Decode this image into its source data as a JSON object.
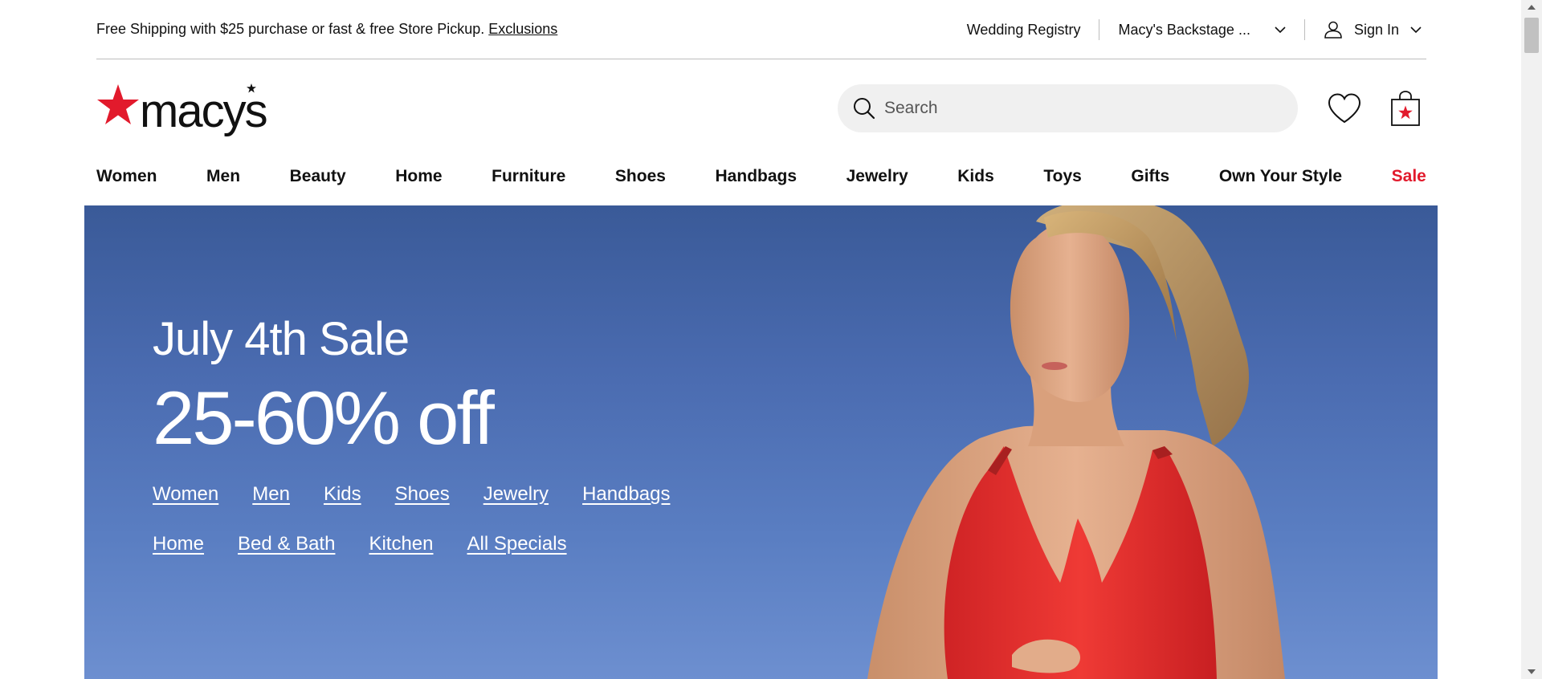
{
  "utility": {
    "promo_text": "Free Shipping with $25 purchase or fast & free Store Pickup.",
    "promo_link": "Exclusions",
    "wedding_registry": "Wedding Registry",
    "store_select": "Macy's Backstage ...",
    "sign_in": "Sign In"
  },
  "header": {
    "logo_text": "macys",
    "search_placeholder": "Search",
    "icons": [
      "search-icon",
      "heart-icon",
      "shopping-bag-icon",
      "user-icon",
      "chevron-down-icon"
    ]
  },
  "nav": {
    "items": [
      {
        "label": "Women"
      },
      {
        "label": "Men"
      },
      {
        "label": "Beauty"
      },
      {
        "label": "Home"
      },
      {
        "label": "Furniture"
      },
      {
        "label": "Shoes"
      },
      {
        "label": "Handbags"
      },
      {
        "label": "Jewelry"
      },
      {
        "label": "Kids"
      },
      {
        "label": "Toys"
      },
      {
        "label": "Gifts"
      },
      {
        "label": "Own Your Style"
      },
      {
        "label": "Sale"
      }
    ]
  },
  "hero": {
    "eyebrow": "July 4th Sale",
    "headline": "25-60% off",
    "links_row1": [
      "Women",
      "Men",
      "Kids",
      "Shoes",
      "Jewelry",
      "Handbags"
    ],
    "links_row2": [
      "Home",
      "Bed & Bath",
      "Kitchen",
      "All Specials"
    ]
  },
  "colors": {
    "brand_red": "#e21a2c",
    "hero_blue": "#4a6bb0",
    "dress_red": "#e8312f"
  }
}
